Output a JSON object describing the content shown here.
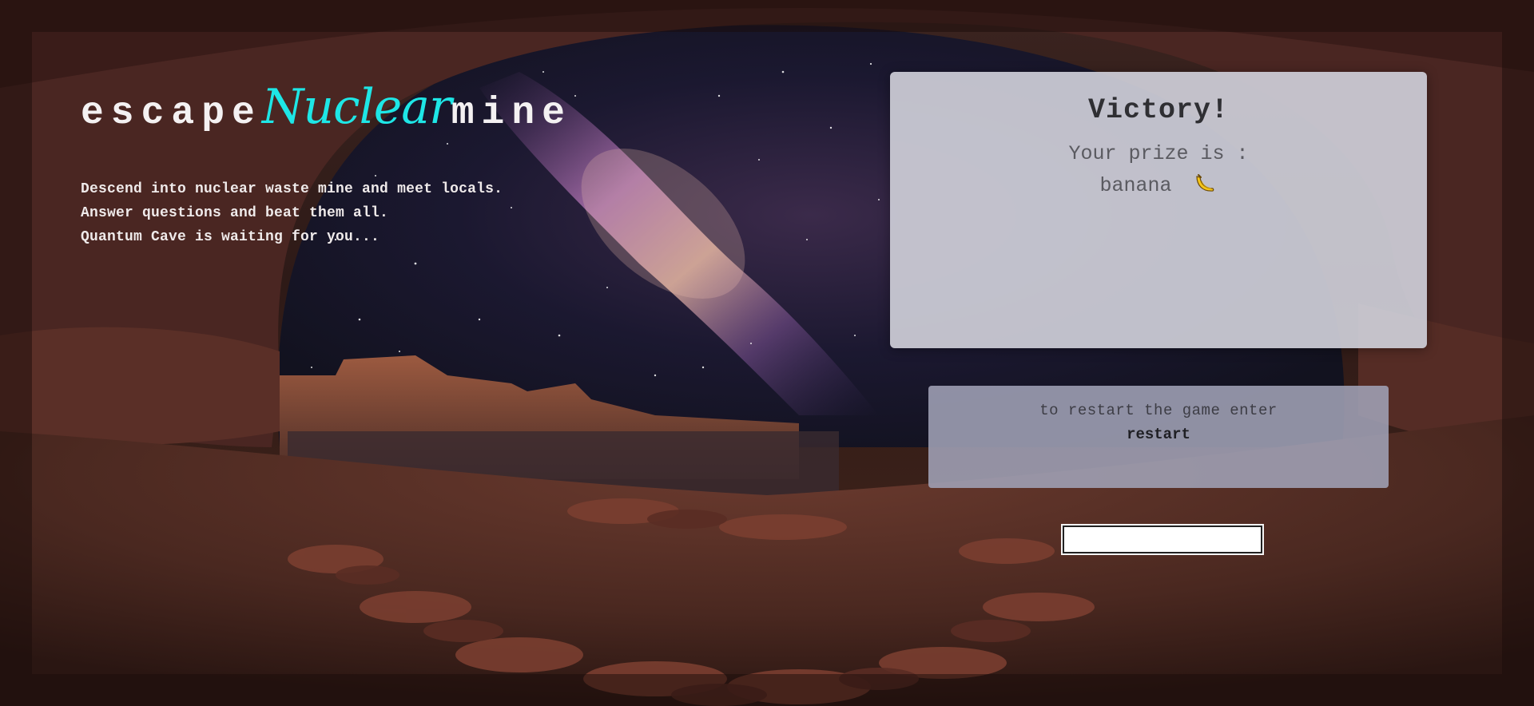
{
  "hero": {
    "title_prefix": "escape",
    "title_accent": "Nuclear",
    "title_suffix": "mine",
    "accent_color": "#1ee6e6",
    "intro_lines": [
      "Descend into nuclear waste mine and meet locals.",
      "Answer questions and beat them all.",
      "Quantum Cave is waiting for you..."
    ]
  },
  "result_panel": {
    "title": "Victory!",
    "prize_label": "Your prize is :",
    "prize_value": "banana",
    "prize_icon": "banana-icon"
  },
  "restart_panel": {
    "hint": "to restart the game enter",
    "command": "restart"
  },
  "command_input": {
    "value": "",
    "placeholder": ""
  }
}
